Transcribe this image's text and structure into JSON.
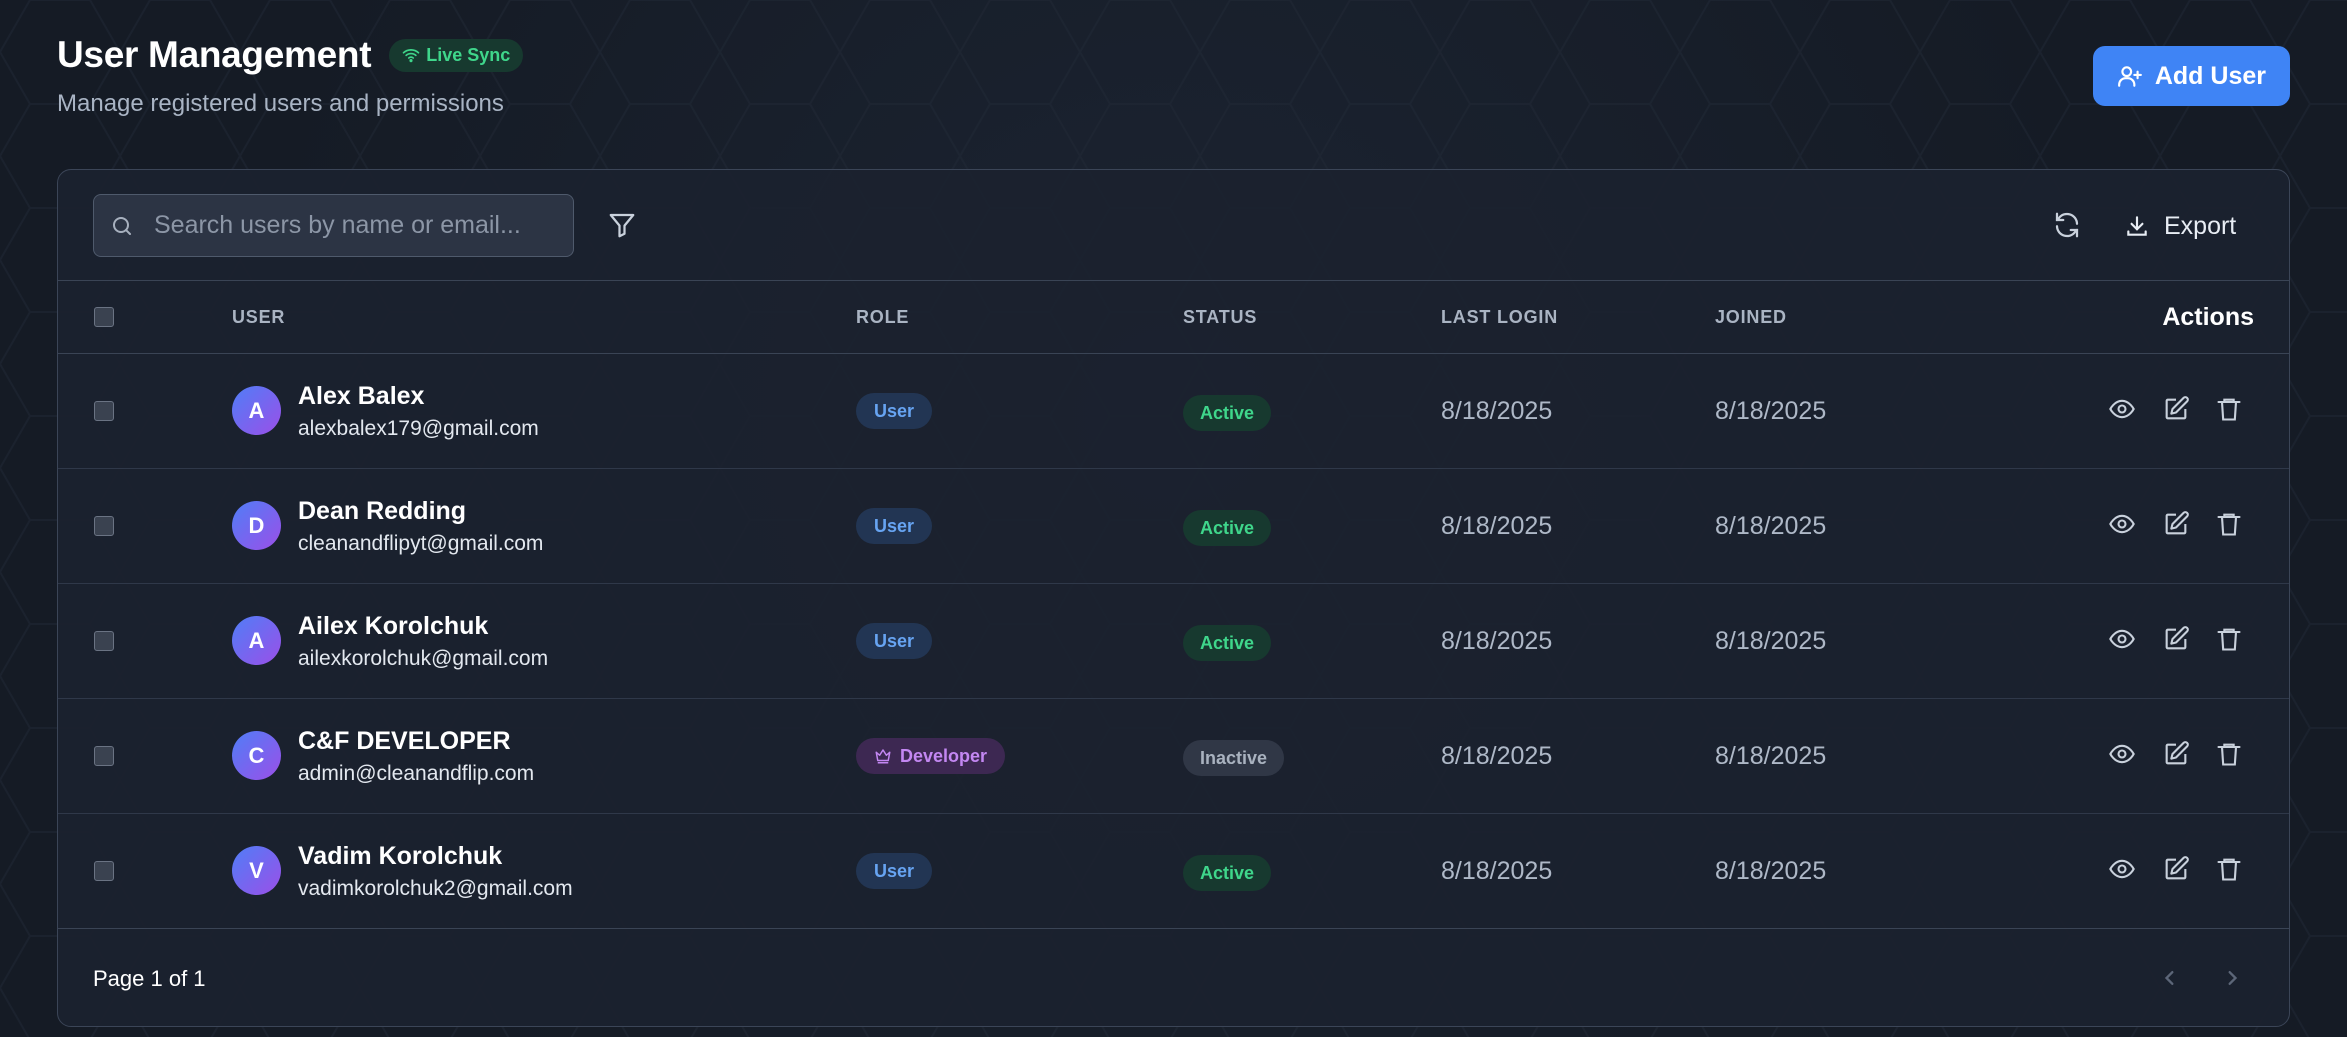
{
  "header": {
    "title": "User Management",
    "live_badge": "Live Sync",
    "subtitle": "Manage registered users and permissions",
    "add_user_label": "Add User"
  },
  "toolbar": {
    "search_placeholder": "Search users by name or email...",
    "export_label": "Export"
  },
  "table": {
    "columns": {
      "user": "USER",
      "role": "ROLE",
      "status": "STATUS",
      "last_login": "LAST LOGIN",
      "joined": "JOINED",
      "actions": "Actions"
    },
    "rows": [
      {
        "initial": "A",
        "name": "Alex Balex",
        "email": "alexbalex179@gmail.com",
        "role": "User",
        "status": "Active",
        "last_login": "8/18/2025",
        "joined": "8/18/2025"
      },
      {
        "initial": "D",
        "name": "Dean Redding",
        "email": "cleanandflipyt@gmail.com",
        "role": "User",
        "status": "Active",
        "last_login": "8/18/2025",
        "joined": "8/18/2025"
      },
      {
        "initial": "A",
        "name": "Ailex Korolchuk",
        "email": "ailexkorolchuk@gmail.com",
        "role": "User",
        "status": "Active",
        "last_login": "8/18/2025",
        "joined": "8/18/2025"
      },
      {
        "initial": "C",
        "name": "C&F DEVELOPER",
        "email": "admin@cleanandflip.com",
        "role": "Developer",
        "status": "Inactive",
        "last_login": "8/18/2025",
        "joined": "8/18/2025"
      },
      {
        "initial": "V",
        "name": "Vadim Korolchuk",
        "email": "vadimkorolchuk2@gmail.com",
        "role": "User",
        "status": "Active",
        "last_login": "8/18/2025",
        "joined": "8/18/2025"
      }
    ]
  },
  "footer": {
    "page_info": "Page 1 of 1"
  },
  "colors": {
    "accent": "#3f84f5",
    "active_text": "#3fd68b",
    "developer_text": "#c387f2",
    "user_role_text": "#67a4f2"
  },
  "icons": {
    "live": "wifi-icon",
    "add_user": "user-plus-icon",
    "search": "search-icon",
    "filter": "filter-icon",
    "refresh": "refresh-icon",
    "export": "download-icon",
    "view": "eye-icon",
    "edit": "edit-icon",
    "delete": "trash-icon",
    "developer": "crown-icon",
    "prev": "chevron-left-icon",
    "next": "chevron-right-icon"
  }
}
